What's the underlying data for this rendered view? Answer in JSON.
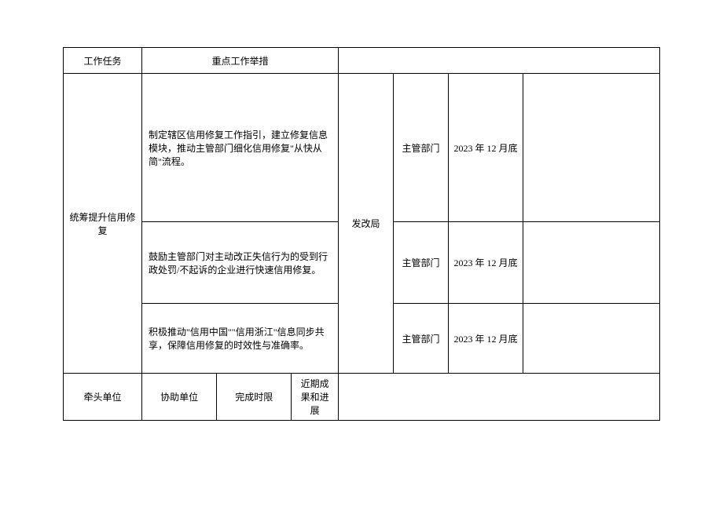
{
  "header": {
    "task": "工作任务",
    "measures": "重点工作举措",
    "lead_unit": "牵头单位",
    "assist_unit": "协助单位",
    "deadline": "完成时限",
    "progress": "近期成果和进展"
  },
  "task": "统筹提升信用修复",
  "lead_unit": "发改局",
  "rows": [
    {
      "measure": "制定辖区信用修复工作指引，建立修复信息模块，推动主管部门细化信用修复\"从快从简\"流程。",
      "assist": "主管部门",
      "deadline": "2023 年 12 月底",
      "progress": ""
    },
    {
      "measure": "鼓励主管部门对主动改正失信行为的受到行政处罚/不起诉的企业进行快速信用修复。",
      "assist": "主管部门",
      "deadline": "2023 年 12 月底",
      "progress": ""
    },
    {
      "measure": "积极推动\"信用中国\"\"信用浙江\"信息同步共享，保障信用修复的时效性与准确率。",
      "assist": "主管部门",
      "deadline": "2023 年 12 月底",
      "progress": ""
    }
  ]
}
